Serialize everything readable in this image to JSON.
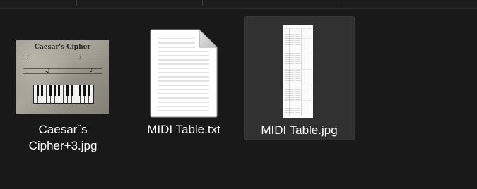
{
  "files": [
    {
      "name": "Caesarˇs\nCipher+3.jpg",
      "type": "jpg-image",
      "thumbnail_title": "Caesar's Cipher",
      "selected": false
    },
    {
      "name": "MIDI  Table.txt",
      "type": "text-document",
      "selected": false
    },
    {
      "name": "MIDI Table.jpg",
      "type": "jpg-image",
      "selected": true
    }
  ],
  "colors": {
    "background": "#191919",
    "selection_fill": "#313131",
    "label_text": "#ffffff"
  }
}
